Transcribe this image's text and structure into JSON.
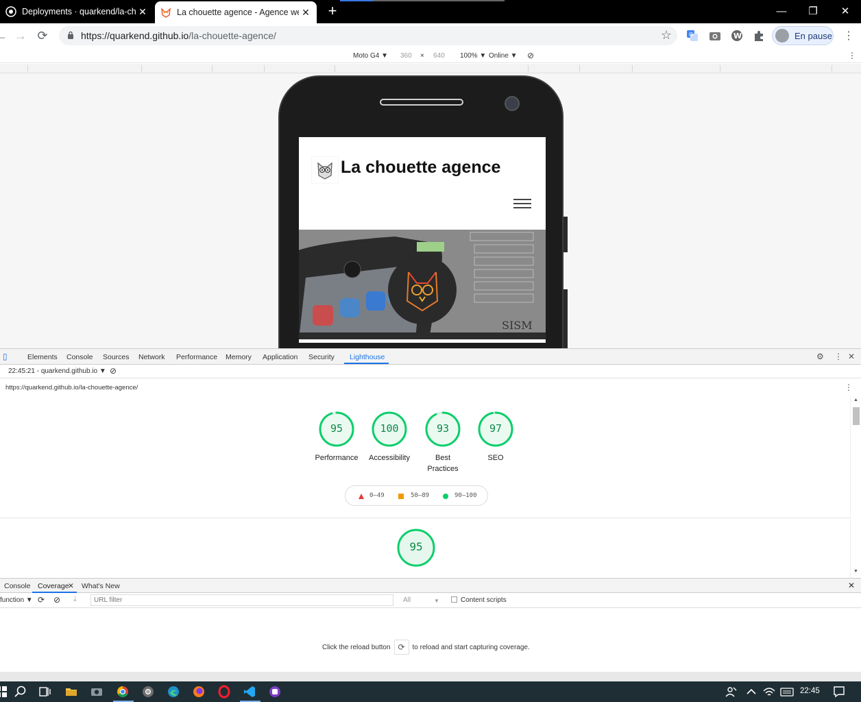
{
  "browser": {
    "tabs": [
      {
        "title": "Deployments · quarkend/la-chou"
      },
      {
        "title": "La chouette agence - Agence we"
      }
    ],
    "url_host": "https://quarkend.github.io",
    "url_path": "/la-chouette-agence/",
    "profile_label": "En pause"
  },
  "device_toolbar": {
    "device": "Moto G4 ▼",
    "width": "360",
    "times": "×",
    "height": "640",
    "zoom": "100% ▼",
    "network": "Online ▼"
  },
  "site": {
    "title": "La chouette agence",
    "hero_text": "SISM"
  },
  "devtools": {
    "tabs": [
      "Elements",
      "Console",
      "Sources",
      "Network",
      "Performance",
      "Memory",
      "Application",
      "Security",
      "Lighthouse"
    ],
    "active_tab": "Lighthouse",
    "report_selector": "22:45:21 - quarkend.github.io ▼",
    "report_url": "https://quarkend.github.io/la-chouette-agence/",
    "scores": [
      {
        "value": 95,
        "label": "Performance"
      },
      {
        "value": 100,
        "label": "Accessibility"
      },
      {
        "value": 93,
        "label": "Best Practices"
      },
      {
        "value": 97,
        "label": "SEO"
      }
    ],
    "legend": [
      {
        "range": "0–49",
        "color": "#e53935"
      },
      {
        "range": "50–89",
        "color": "#f29900"
      },
      {
        "range": "90–100",
        "color": "#0cce6b"
      }
    ],
    "detail_score": 95
  },
  "drawer": {
    "tabs": [
      "Console",
      "Coverage",
      "What's New"
    ],
    "active_tab": "Coverage",
    "per_function": "function ▼",
    "url_filter_placeholder": "URL filter",
    "type_filter": "All",
    "content_scripts_label": "Content scripts",
    "message_before": "Click the reload button",
    "message_after": "to reload and start capturing coverage."
  },
  "taskbar": {
    "time": "22:45"
  },
  "colors": {
    "score_green": "#0cce6b",
    "score_text": "#0c8a49",
    "accent_blue": "#1a73e8"
  }
}
